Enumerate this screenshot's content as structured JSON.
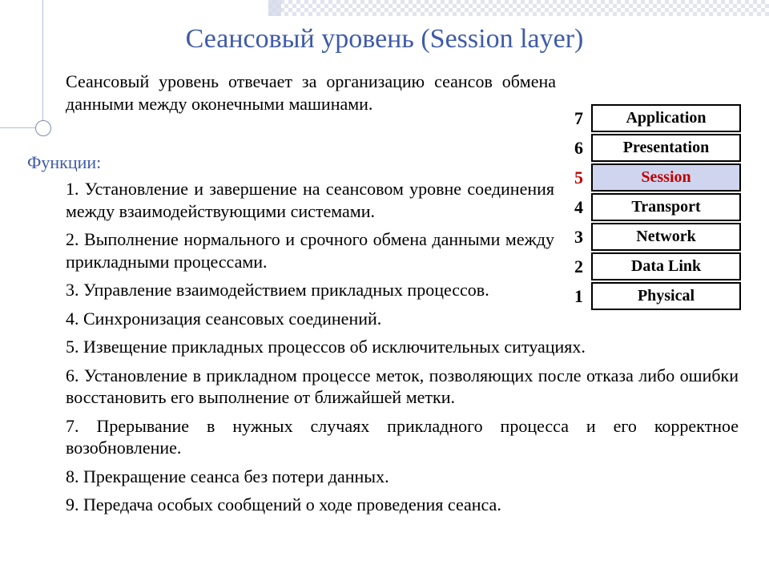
{
  "title": "Сеансовый уровень (Session layer)",
  "intro": "Сеансовый уровень отвечает за организацию сеансов обмена данными между оконечными машинами.",
  "functions_label": "Функции:",
  "functions": {
    "f1": "1. Установление и завершение на сеансовом уровне соединения между взаимодействующими системами.",
    "f2": "2. Выполнение нормального и срочного обмена данными между прикладными процессами.",
    "f3": "3. Управление взаимодействием прикладных процессов.",
    "f4": "4.  Синхронизация сеансовых соединений.",
    "f5": "5.  Извещение прикладных процессов об исключительных ситуациях.",
    "f6": "6. Установление в прикладном процессе меток, позволяющих после отказа либо ошибки восстановить его выполнение от ближайшей метки.",
    "f7": "7. Прерывание в нужных случаях прикладного процесса и его корректное возобновление.",
    "f8": "8.  Прекращение сеанса без потери данных.",
    "f9": "9. Передача особых сообщений о ходе проведения сеанса."
  },
  "osi": {
    "l7": {
      "num": "7",
      "name": "Application"
    },
    "l6": {
      "num": "6",
      "name": "Presentation"
    },
    "l5": {
      "num": "5",
      "name": "Session"
    },
    "l4": {
      "num": "4",
      "name": "Transport"
    },
    "l3": {
      "num": "3",
      "name": "Network"
    },
    "l2": {
      "num": "2",
      "name": "Data Link"
    },
    "l1": {
      "num": "1",
      "name": "Physical"
    }
  }
}
